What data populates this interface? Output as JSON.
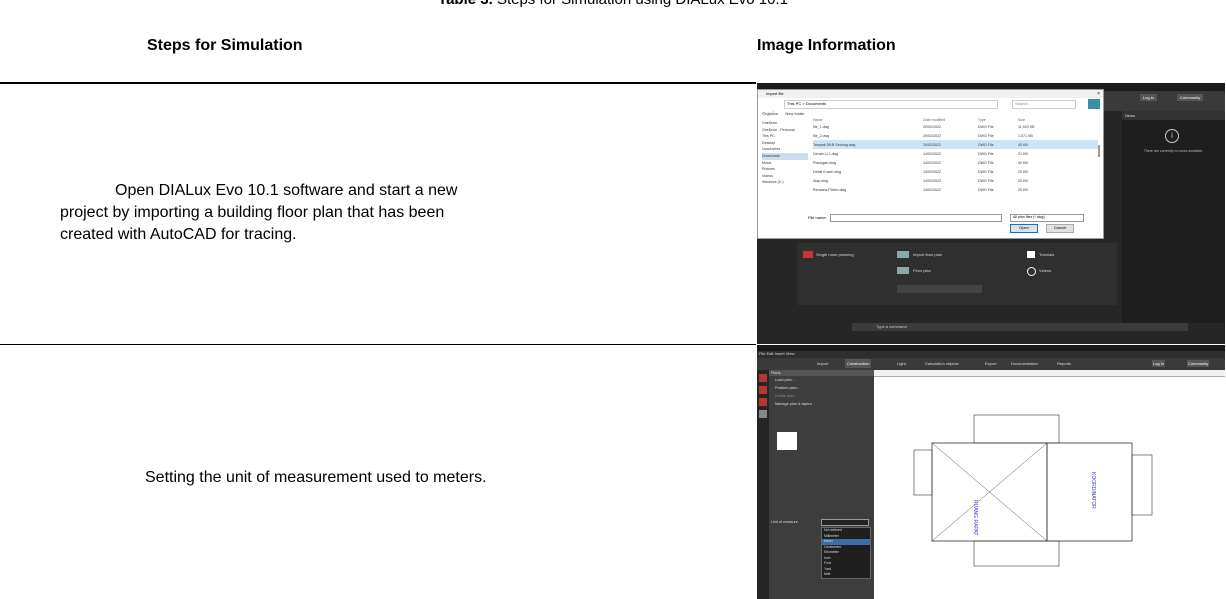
{
  "caption": {
    "prefix": "Table 3.",
    "text": "Steps for Simulation using DIALux Evo 10.1"
  },
  "table": {
    "headers": {
      "steps": "Steps for Simulation",
      "image": "Image Information"
    },
    "rows": [
      {
        "step_line1": "Open DIALux Evo 10.1 software and start a new",
        "step_line2": "project by importing a building floor plan that has been",
        "step_line3": "created with AutoCAD for tracing."
      },
      {
        "step_line1": "Setting the unit of measurement used to meters."
      }
    ]
  },
  "shot1": {
    "dialog_title": "Import file",
    "path": "This PC > Documents",
    "search": "Search",
    "toolbar": [
      "Organize",
      "New folder"
    ],
    "sidebar": [
      "OneDrive",
      "OneDrive - Personal",
      "This PC",
      "Desktop",
      "Documents",
      "Downloads",
      "Music",
      "Pictures",
      "Videos",
      "Windows (C:)"
    ],
    "columns": [
      "Name",
      "Date modified",
      "Type",
      "Size"
    ],
    "files": [
      {
        "name": "file_1.dwg",
        "date": "20/02/2022",
        "type": "DWG File",
        "size": "11,923 KB"
      },
      {
        "name": "file_2.dwg",
        "date": "20/02/2022",
        "type": "DWG File",
        "size": "1,071 KB"
      },
      {
        "name": "Tampak DKB Gedung.dwg",
        "date": "20/02/2022",
        "type": "DWG File",
        "size": "40 KB"
      },
      {
        "name": "Denah Lt 1.dwg",
        "date": "14/02/2022",
        "type": "DWG File",
        "size": "31 KB"
      },
      {
        "name": "Potongan.dwg",
        "date": "14/02/2022",
        "type": "DWG File",
        "size": "40 KB"
      },
      {
        "name": "Detail Kusen.dwg",
        "date": "14/02/2022",
        "type": "DWG File",
        "size": "20 KB"
      },
      {
        "name": "Atap.dwg",
        "date": "14/02/2022",
        "type": "DWG File",
        "size": "20 KB"
      },
      {
        "name": "Rencana Plafon.dwg",
        "date": "14/02/2022",
        "type": "DWG File",
        "size": "20 KB"
      }
    ],
    "filename_label": "File name:",
    "filetype": "All plan files (*.dwg)",
    "open_btn": "Open",
    "cancel_btn": "Cancel",
    "start_tiles": [
      "Single room planning",
      "Import floor plan",
      "Floor plan",
      "Tutorials",
      "Videos"
    ],
    "right_panel_header": "News",
    "right_panel_msg": "There are currently no news available.",
    "top_right": [
      "Log in",
      "Community"
    ],
    "bottom_bar": "Type a command"
  },
  "shot2": {
    "menus": [
      "File",
      "Edit",
      "Insert",
      "View"
    ],
    "tabs": [
      "Import",
      "Construction",
      "Light",
      "Calculation objects",
      "Export",
      "Documentation",
      "Reports"
    ],
    "panel_title": "Plans",
    "panel_items": [
      "Load plan...",
      "Position plan...",
      "Delete plan",
      "Manage plan & layers"
    ],
    "unit_label": "Unit of measure",
    "unit_options": [
      "Not defined",
      "Millimeter",
      "Meter",
      "Centimeter",
      "Kilometer",
      "Inch",
      "Foot",
      "Yard",
      "Mile"
    ],
    "selected_unit": "Meter",
    "room_label_1": "RUANG RAPAT",
    "room_label_2": "KOORDINATOR",
    "top_right": [
      "Log in",
      "Community"
    ]
  }
}
